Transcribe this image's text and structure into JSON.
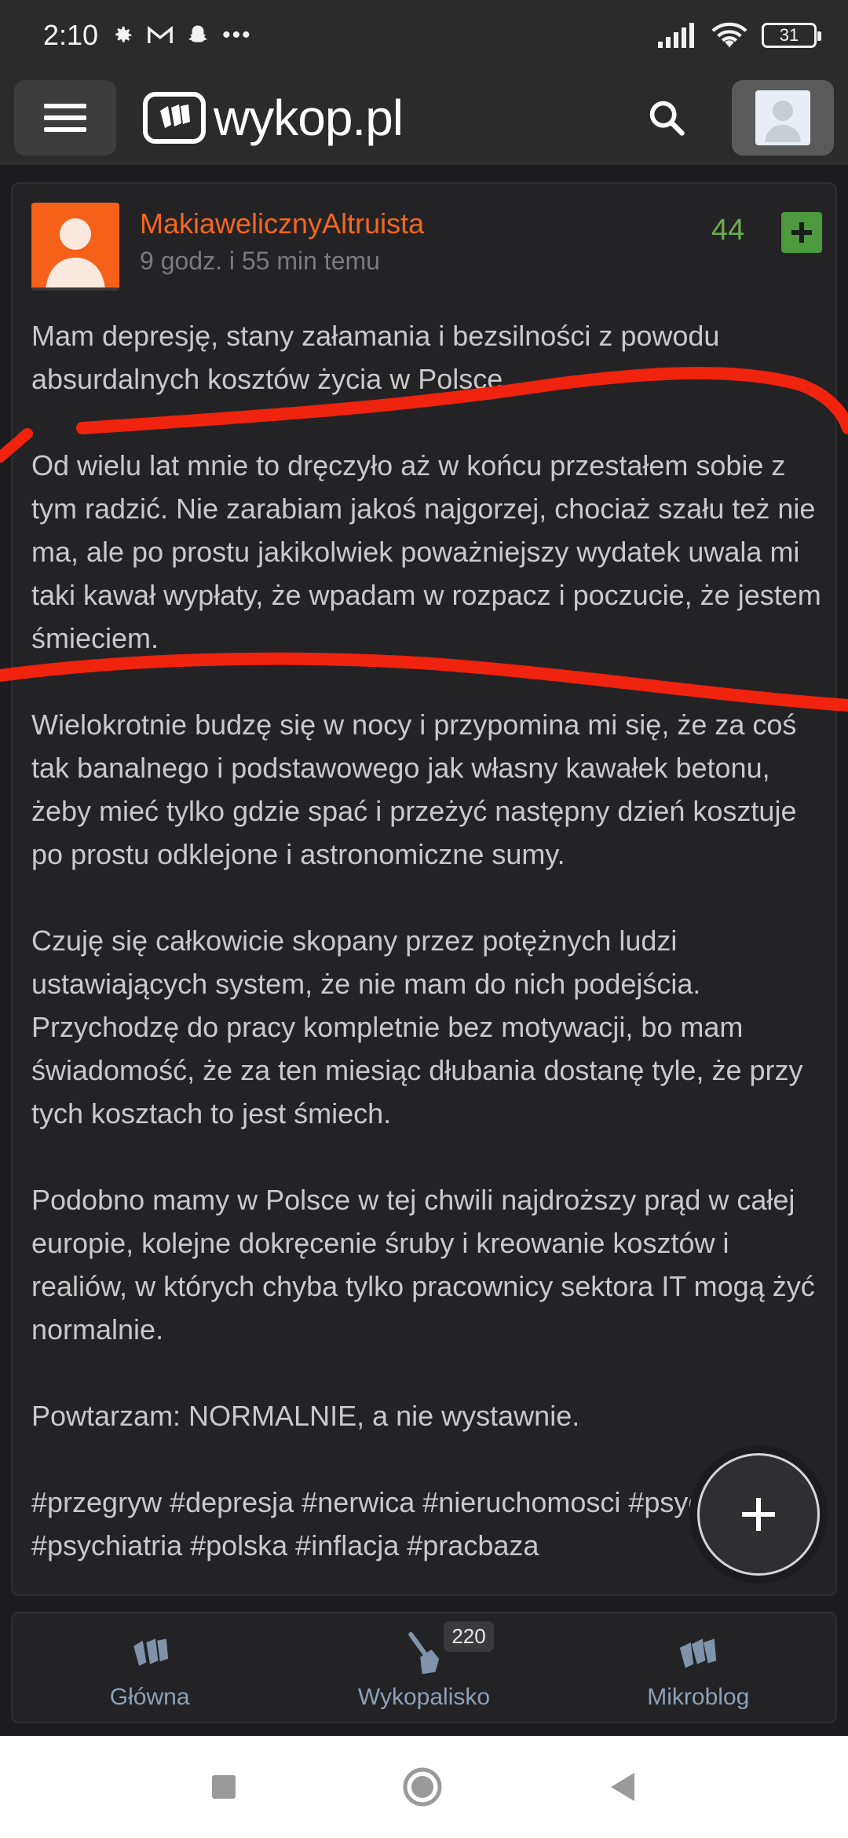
{
  "status_bar": {
    "time": "2:10",
    "dots": "•••",
    "battery": "31"
  },
  "header": {
    "logo_text": "wykop.pl"
  },
  "post": {
    "username": "MakiawelicznyAltruista",
    "timestamp": "9 godz. i 55 min temu",
    "votes": "44",
    "paragraphs": [
      "Mam depresję, stany załamania i bezsilności z powodu absurdalnych kosztów życia w Polsce.",
      "Od wielu lat mnie to dręczyło aż w końcu przestałem sobie z tym radzić. Nie zarabiam jakoś najgorzej, chociaż szału też nie ma, ale po prostu jakikolwiek poważniejszy wydatek uwala mi taki kawał wypłaty, że wpadam w rozpacz i poczucie, że jestem śmieciem.",
      "Wielokrotnie budzę się w nocy i przypomina mi się, że za coś tak banalnego i podstawowego jak własny kawałek betonu, żeby mieć tylko gdzie spać i przeżyć następny dzień kosztuje po prostu odklejone i astronomiczne sumy.",
      "Czuję się całkowicie skopany przez potężnych ludzi ustawiających system, że nie mam do nich podejścia. Przychodzę do pracy kompletnie bez motywacji, bo mam świadomość, że za ten miesiąc dłubania dostanę tyle, że przy tych kosztach to jest śmiech.",
      "Podobno mamy w Polsce w tej chwili najdroższy prąd w całej europie, kolejne dokręcenie śruby i kreowanie kosztów i realiów, w których chyba tylko pracownicy sektora IT mogą żyć normalnie.",
      "Powtarzam: NORMALNIE, a nie wystawnie."
    ],
    "tags": "#przegryw #depresja #nerwica #nieruchomosci #psychologia #psychiatria #polska #inflacja #pracbaza"
  },
  "fab": {
    "label": "+"
  },
  "bottom_nav": {
    "items": [
      {
        "label": "Główna"
      },
      {
        "label": "Wykopalisko",
        "badge": "220"
      },
      {
        "label": "Mikroblog"
      }
    ]
  },
  "colors": {
    "accent_orange": "#f5661f",
    "vote_green": "#6dab4e",
    "annotation_red": "#f0230e"
  }
}
